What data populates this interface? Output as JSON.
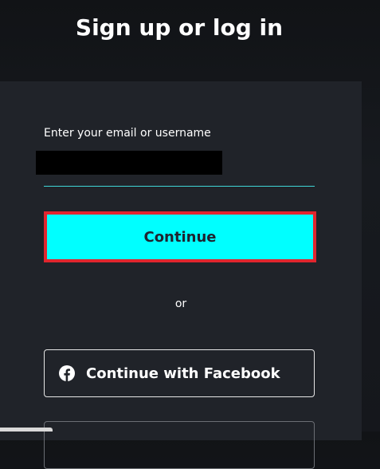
{
  "header": {
    "title": "Sign up or log in"
  },
  "form": {
    "email_label": "Enter your email or username",
    "continue_label": "Continue",
    "or_text": "or",
    "facebook_label": "Continue with Facebook"
  },
  "colors": {
    "accent": "#00ffff",
    "highlight_border": "#e0262e",
    "card_background": "#202329",
    "page_background": "#15171c"
  },
  "icons": {
    "facebook": "facebook-icon"
  }
}
